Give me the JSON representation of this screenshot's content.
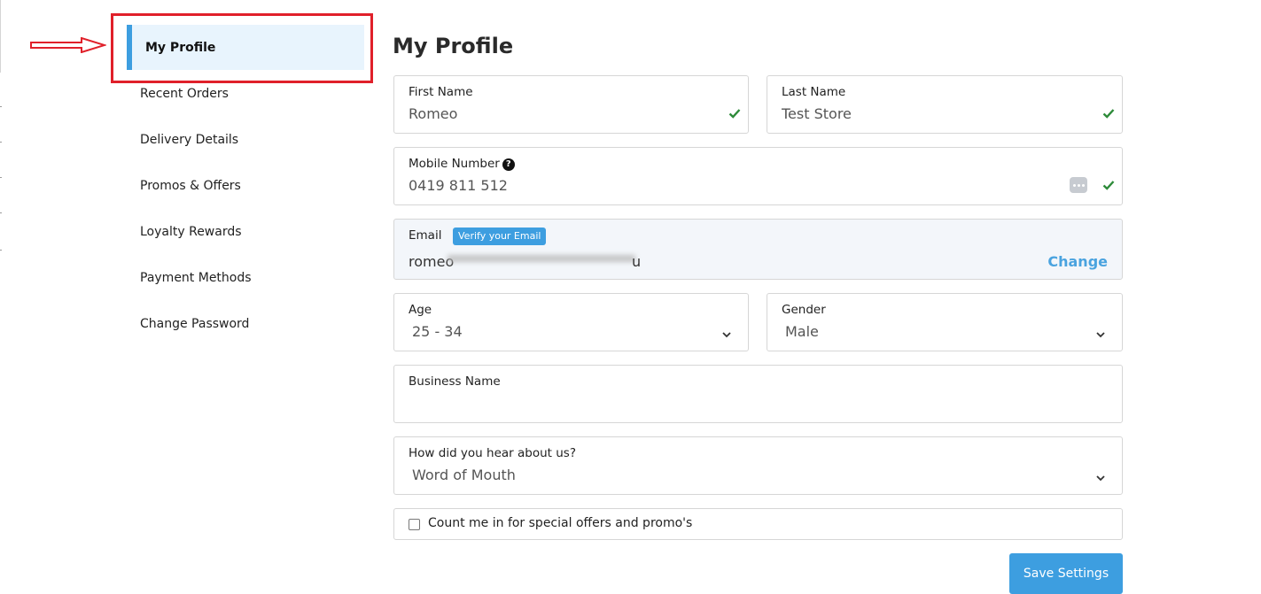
{
  "sidebar": {
    "active": "My Profile",
    "items": [
      "Recent Orders",
      "Delivery Details",
      "Promos & Offers",
      "Loyalty Rewards",
      "Payment Methods",
      "Change Password"
    ]
  },
  "main": {
    "title": "My Profile",
    "first_name": {
      "label": "First Name",
      "value": "Romeo"
    },
    "last_name": {
      "label": "Last Name",
      "value": "Test Store"
    },
    "mobile": {
      "label": "Mobile Number",
      "value": "0419 811 512"
    },
    "email": {
      "label": "Email",
      "verify_badge": "Verify your Email",
      "value_prefix": "romeo",
      "value_suffix": "u",
      "change": "Change"
    },
    "age": {
      "label": "Age",
      "value": "25 - 34"
    },
    "gender": {
      "label": "Gender",
      "value": "Male"
    },
    "business": {
      "label": "Business Name",
      "value": ""
    },
    "hear": {
      "label": "How did you hear about us?",
      "value": "Word of Mouth"
    },
    "promo_checkbox": {
      "label": "Count me in for special offers and promo's",
      "checked": false
    },
    "save_button": "Save Settings"
  },
  "colors": {
    "accent": "#3d9ee0",
    "active_bg": "#e8f4fd",
    "annotation_red": "#e0202a",
    "check_green": "#2e8b3a"
  },
  "icons": [
    "arrow-right-icon",
    "checkmark-icon",
    "help-icon",
    "sms-icon",
    "chevron-down-icon"
  ]
}
